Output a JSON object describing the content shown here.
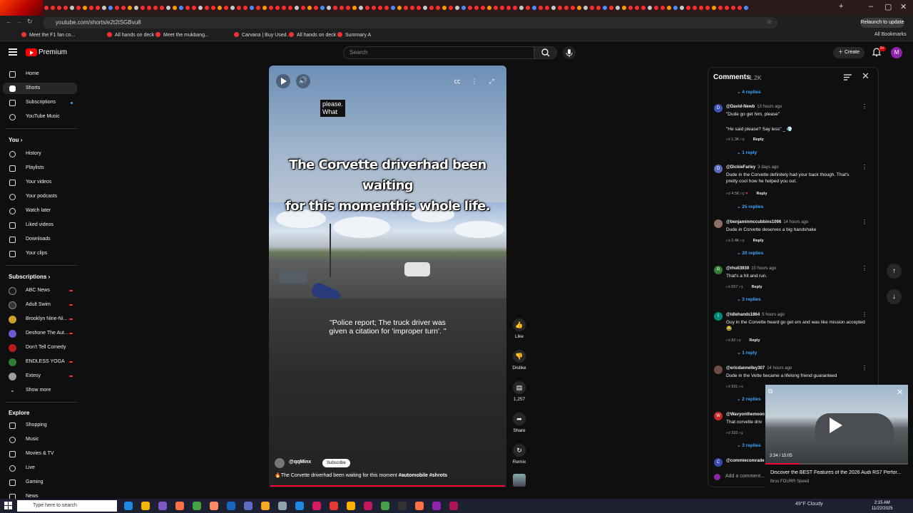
{
  "browser": {
    "url": "youtube.com/shorts/e2t2tSGBvu8",
    "relaunch_label": "Relaunch to update",
    "bookmarks": [
      "Meet the F1 fan co...",
      "All hands on deck",
      "Meet the mukbang...",
      "Carvana | Buy Used...",
      "All hands on deck",
      "Summary A"
    ],
    "all_bookmarks": "All Bookmarks"
  },
  "header": {
    "brand": "Premium",
    "search_placeholder": "Search",
    "create_label": "Create",
    "notification_count": "9+",
    "avatar_letter": "M"
  },
  "sidebar": {
    "main": [
      {
        "label": "Home",
        "icon": "home-icon"
      },
      {
        "label": "Shorts",
        "icon": "shorts-icon",
        "active": true
      },
      {
        "label": "Subscriptions",
        "icon": "subscriptions-icon"
      },
      {
        "label": "YouTube Music",
        "icon": "music-icon"
      }
    ],
    "you_title": "You",
    "you": [
      {
        "label": "History",
        "icon": "history-icon"
      },
      {
        "label": "Playlists",
        "icon": "playlists-icon"
      },
      {
        "label": "Your videos",
        "icon": "videos-icon"
      },
      {
        "label": "Your podcasts",
        "icon": "podcasts-icon"
      },
      {
        "label": "Watch later",
        "icon": "clock-icon"
      },
      {
        "label": "Liked videos",
        "icon": "thumb-up-icon"
      },
      {
        "label": "Downloads",
        "icon": "download-icon"
      },
      {
        "label": "Your clips",
        "icon": "scissors-icon"
      }
    ],
    "subs_title": "Subscriptions",
    "subs": [
      {
        "label": "ABC News",
        "color": "#1a1a1a"
      },
      {
        "label": "Adult Swim",
        "color": "#333333"
      },
      {
        "label": "Brooklyn Nine-Ni...",
        "color": "#c9a227"
      },
      {
        "label": "Deshone The Aut...",
        "color": "#6b5bd2"
      },
      {
        "label": "Don't Tell Comedy",
        "color": "#b71c1c"
      },
      {
        "label": "ENDLESS YOGA",
        "color": "#2e7d32"
      },
      {
        "label": "Extesy",
        "color": "#9e9e9e"
      }
    ],
    "show_more": "Show more",
    "explore_title": "Explore",
    "explore": [
      {
        "label": "Shopping",
        "icon": "bag-icon"
      },
      {
        "label": "Music",
        "icon": "music-note-icon"
      },
      {
        "label": "Movies & TV",
        "icon": "film-icon"
      },
      {
        "label": "Live",
        "icon": "live-icon"
      },
      {
        "label": "Gaming",
        "icon": "gamepad-icon"
      },
      {
        "label": "News",
        "icon": "news-icon"
      }
    ]
  },
  "video": {
    "caption_small_1": "please.",
    "caption_small_2": "What",
    "caption_line_1": "The Corvette driverhad been waiting",
    "caption_line_2": "for this momenthis whole life.",
    "quote_1": "\"Police report; The truck driver was",
    "quote_2": "given a citation for 'improper turn'. \"",
    "channel": "@qqMinx",
    "subscribe_label": "Subscribe",
    "title": "The Corvette driverhad been waiting for this moment",
    "tags": "#automobile #shrots"
  },
  "actions": {
    "like": "Like",
    "dislike": "Dislike",
    "comments": "1,257",
    "share": "Share",
    "remix": "Remix"
  },
  "comments": {
    "title": "Comments",
    "count": "1.2K",
    "top_replies": "4 replies",
    "items": [
      {
        "avatar": "D",
        "color": "#3f51b5",
        "author": "@David-Newb",
        "time": "13 hours ago",
        "text": "\"Dude go get him, please\"",
        "text2": "\"He said please? Say less\" _ 💨",
        "likes": "1.3K",
        "replies": "1 reply"
      },
      {
        "avatar": "D",
        "color": "#5c6bc0",
        "author": "@DickieFarley",
        "time": "3 days ago",
        "text": "Dude in the Corvette definitely had your back though. That's pretty cool how he helped you out.",
        "likes": "4.5K",
        "replies": "25 replies"
      },
      {
        "avatar": "",
        "color": "#8d6e63",
        "author": "@benjaminmccubbins1096",
        "time": "14 hours ago",
        "text": "Dude in Corvette deserves a big handshake",
        "likes": "2.4K",
        "replies": "20 replies"
      },
      {
        "avatar": "R",
        "color": "#2e7d32",
        "author": "@rhull3939",
        "time": "10 hours ago",
        "text": "That's a hit and run.",
        "likes": "657",
        "replies": "3 replies"
      },
      {
        "avatar": "I",
        "color": "#00897b",
        "author": "@idlehands1864",
        "time": "5 hours ago",
        "text": "Guy in the Corvette heard go get em and was like mission accepted😂",
        "likes": "82",
        "replies": "1 reply"
      },
      {
        "avatar": "",
        "color": "#6d4c41",
        "author": "@ericdannelley307",
        "time": "14 hours ago",
        "text": "Dude in the Vette became a lifelong friend guaranteed",
        "likes": "931",
        "replies": "2 replies"
      },
      {
        "avatar": "W",
        "color": "#c62828",
        "author": "@Wavyonthemoon",
        "time": "",
        "text": "That corvette driv",
        "likes": "332",
        "replies": "3 replies"
      },
      {
        "avatar": "C",
        "color": "#3949ab",
        "author": "@commiecomrade",
        "time": "",
        "text": "",
        "likes": "",
        "replies": ""
      }
    ],
    "reply_label": "Reply",
    "add_comment": "Add a comment..."
  },
  "miniplayer": {
    "time": "3:34 / 15:05",
    "progress_fraction": 0.24,
    "title": "Discover the BEST Features of the 2026 Audi RS7 Perfor...",
    "channel": "Bros FOURR Speed"
  },
  "taskbar": {
    "search_placeholder": "Type here to search",
    "weather": "49°F  Cloudy",
    "time": "2:15 AM",
    "date": "11/22/2025"
  }
}
